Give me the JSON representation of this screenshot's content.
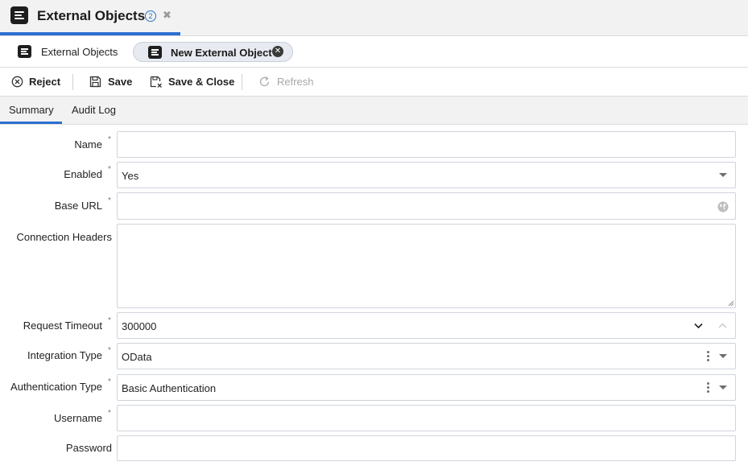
{
  "window": {
    "title": "External Objects",
    "badge_count": "2"
  },
  "record_tabs": [
    {
      "label": "External Objects",
      "active": false
    },
    {
      "label": "New External Object",
      "active": true
    }
  ],
  "toolbar": {
    "reject_label": "Reject",
    "save_label": "Save",
    "save_close_label": "Save & Close",
    "refresh_label": "Refresh"
  },
  "form_tabs": [
    {
      "label": "Summary",
      "active": true
    },
    {
      "label": "Audit Log",
      "active": false
    }
  ],
  "form": {
    "name": {
      "label": "Name",
      "required": true,
      "value": ""
    },
    "enabled": {
      "label": "Enabled",
      "required": true,
      "value": "Yes"
    },
    "base_url": {
      "label": "Base URL",
      "required": true,
      "value": ""
    },
    "connection_headers": {
      "label": "Connection Headers",
      "required": false,
      "value": ""
    },
    "request_timeout": {
      "label": "Request Timeout",
      "required": true,
      "value": "300000"
    },
    "integration_type": {
      "label": "Integration Type",
      "required": true,
      "value": "OData"
    },
    "authentication_type": {
      "label": "Authentication Type",
      "required": true,
      "value": "Basic Authentication"
    },
    "username": {
      "label": "Username",
      "required": true,
      "value": ""
    },
    "password": {
      "label": "Password",
      "required": false,
      "value": ""
    }
  },
  "colors": {
    "accent": "#2b6fd1",
    "border": "#cfd4dc",
    "header_bg": "#f2f2f2"
  },
  "icons": [
    "menu-list-icon",
    "close-icon",
    "reject-circle-x-icon",
    "save-disk-icon",
    "save-close-icon",
    "refresh-icon",
    "globe-icon",
    "chevron-down-icon",
    "chevron-up-icon",
    "kebab-icon",
    "dropdown-caret-icon",
    "textarea-resize-icon"
  ]
}
